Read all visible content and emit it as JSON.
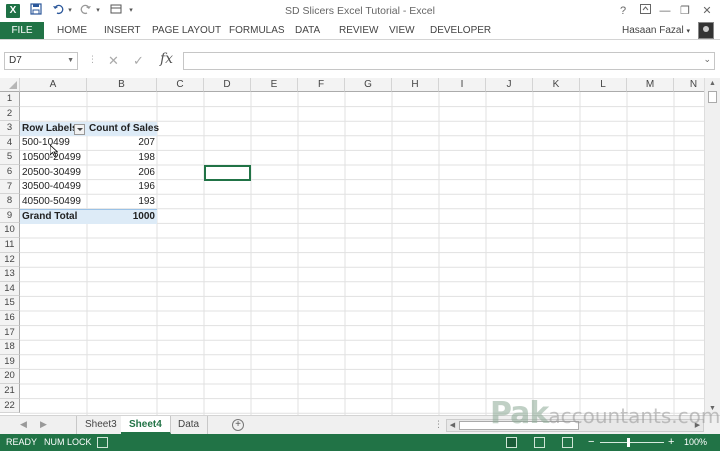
{
  "window": {
    "title": "SD Slicers Excel Tutorial - Excel",
    "help_icon": "?",
    "minimize_icon": "—",
    "restore_icon": "❐",
    "close_icon": "✕"
  },
  "quick_access": {
    "save_icon": "save-icon",
    "undo_icon": "undo-icon",
    "redo_icon": "redo-icon"
  },
  "ribbon": {
    "file_label": "FILE",
    "tabs": [
      "HOME",
      "INSERT",
      "PAGE LAYOUT",
      "FORMULAS",
      "DATA",
      "REVIEW",
      "VIEW",
      "DEVELOPER"
    ],
    "user_name": "Hasaan Fazal"
  },
  "formula_bar": {
    "name_box": "D7",
    "fx_label": "fx",
    "formula": ""
  },
  "columns": [
    "A",
    "B",
    "C",
    "D",
    "E",
    "F",
    "G",
    "H",
    "I",
    "J",
    "K",
    "L",
    "M",
    "N"
  ],
  "rows": [
    "1",
    "2",
    "3",
    "4",
    "5",
    "6",
    "7",
    "8",
    "9",
    "10",
    "11",
    "12",
    "13",
    "14",
    "15",
    "16",
    "17",
    "18",
    "19",
    "20",
    "21",
    "22"
  ],
  "pivot": {
    "header_row_labels": "Row Labels",
    "header_count": "Count of Sales",
    "items": [
      {
        "label": "500-10499",
        "value": "207"
      },
      {
        "label": "10500-20499",
        "value": "198"
      },
      {
        "label": "20500-30499",
        "value": "206"
      },
      {
        "label": "30500-40499",
        "value": "196"
      },
      {
        "label": "40500-50499",
        "value": "193"
      }
    ],
    "total_label": "Grand Total",
    "total_value": "1000"
  },
  "sheets": {
    "tabs": [
      {
        "name": "Sheet3",
        "active": false
      },
      {
        "name": "Sheet4",
        "active": true
      },
      {
        "name": "Data",
        "active": false
      }
    ],
    "add_label": "+"
  },
  "status": {
    "ready": "READY",
    "num_lock": "NUM LOCK",
    "zoom_minus": "−",
    "zoom_plus": "+",
    "zoom": "100%",
    "zoom_level_fraction": 0.5
  },
  "watermark": {
    "brand": "Pak",
    "rest": "accountants.com"
  },
  "colors": {
    "excel_green": "#217346",
    "pivot_header": "#ddebf7",
    "gridline": "#e1e1e1"
  }
}
